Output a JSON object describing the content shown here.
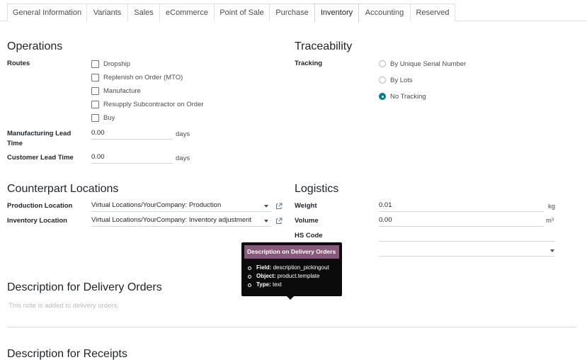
{
  "tabs": [
    {
      "label": "General Information",
      "active": false
    },
    {
      "label": "Variants",
      "active": false
    },
    {
      "label": "Sales",
      "active": false
    },
    {
      "label": "eCommerce",
      "active": false
    },
    {
      "label": "Point of Sale",
      "active": false
    },
    {
      "label": "Purchase",
      "active": false
    },
    {
      "label": "Inventory",
      "active": true
    },
    {
      "label": "Accounting",
      "active": false
    },
    {
      "label": "Reserved",
      "active": false
    }
  ],
  "operations": {
    "title": "Operations",
    "routes_label": "Routes",
    "routes": [
      {
        "label": "Dropship",
        "checked": false
      },
      {
        "label": "Replenish on Order (MTO)",
        "checked": false
      },
      {
        "label": "Manufacture",
        "checked": false
      },
      {
        "label": "Resupply Subcontractor on Order",
        "checked": false
      },
      {
        "label": "Buy",
        "checked": false
      }
    ],
    "manufacturing_lead_label": "Manufacturing Lead Time",
    "manufacturing_lead_value": "0.00",
    "manufacturing_lead_unit": "days",
    "customer_lead_label": "Customer Lead Time",
    "customer_lead_value": "0.00",
    "customer_lead_unit": "days"
  },
  "traceability": {
    "title": "Traceability",
    "tracking_label": "Tracking",
    "options": [
      {
        "label": "By Unique Serial Number",
        "checked": false
      },
      {
        "label": "By Lots",
        "checked": false
      },
      {
        "label": "No Tracking",
        "checked": true
      }
    ]
  },
  "counterpart": {
    "title": "Counterpart Locations",
    "production_label": "Production Location",
    "production_value": "Virtual Locations/YourCompany: Production",
    "inventory_label": "Inventory Location",
    "inventory_value": "Virtual Locations/YourCompany: Inventory adjustment"
  },
  "logistics": {
    "title": "Logistics",
    "weight_label": "Weight",
    "weight_value": "0.01",
    "weight_unit": "kg",
    "volume_label": "Volume",
    "volume_value": "0.00",
    "volume_unit": "m³",
    "hs_code_label": "HS Code",
    "hs_code_value": "",
    "origin_value": ""
  },
  "delivery": {
    "title": "Description for Delivery Orders",
    "placeholder": "This note is added to delivery orders."
  },
  "receipts": {
    "title": "Description for Receipts"
  },
  "tooltip": {
    "title": "Description on Delivery Orders",
    "field_key": "Field:",
    "field_value": "description_pickingout",
    "object_key": "Object:",
    "object_value": "product.template",
    "type_key": "Type:",
    "type_value": "text"
  },
  "colors": {
    "accent": "#017e84",
    "tooltip_header": "#875a7b"
  }
}
